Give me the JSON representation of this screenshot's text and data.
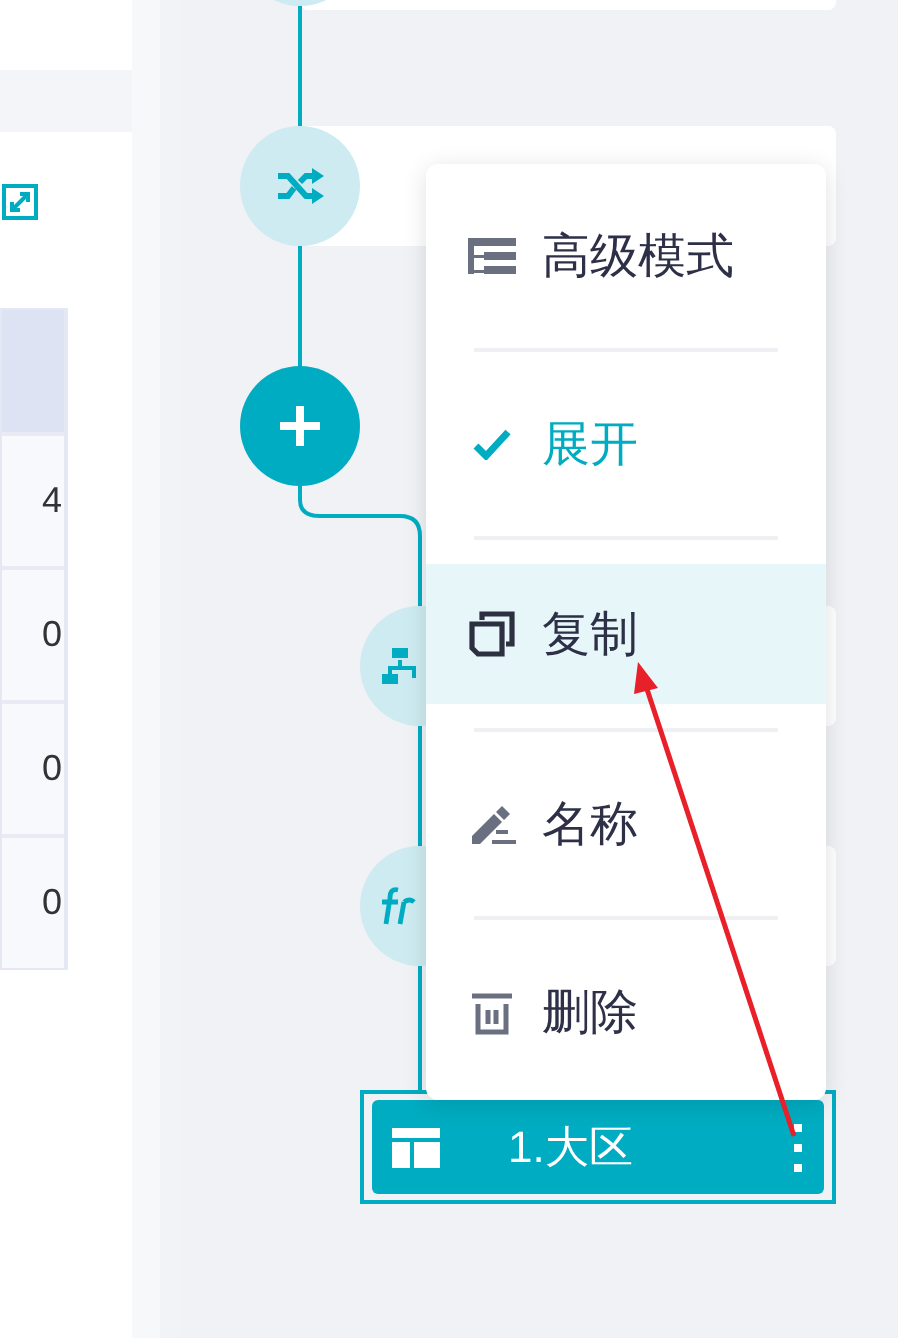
{
  "left_panel": {
    "table": {
      "rows": [
        {
          "column_1": "4"
        },
        {
          "column_1": "0"
        },
        {
          "column_1": "0"
        },
        {
          "column_1": "0"
        }
      ]
    }
  },
  "flow": {
    "nodes": [
      {
        "kind": "shuffle"
      },
      {
        "kind": "add"
      },
      {
        "kind": "branch"
      },
      {
        "kind": "formula"
      }
    ],
    "selected_node": {
      "label": "1.大区"
    }
  },
  "context_menu": {
    "items": [
      {
        "kind": "advanced",
        "label": "高级模式",
        "checked": false,
        "selected": false
      },
      {
        "kind": "expand",
        "label": "展开",
        "checked": true,
        "selected": false
      },
      {
        "kind": "copy",
        "label": "复制",
        "checked": false,
        "selected": true
      },
      {
        "kind": "rename",
        "label": "名称",
        "checked": false,
        "selected": false
      },
      {
        "kind": "delete",
        "label": "删除",
        "checked": false,
        "selected": false
      }
    ]
  }
}
